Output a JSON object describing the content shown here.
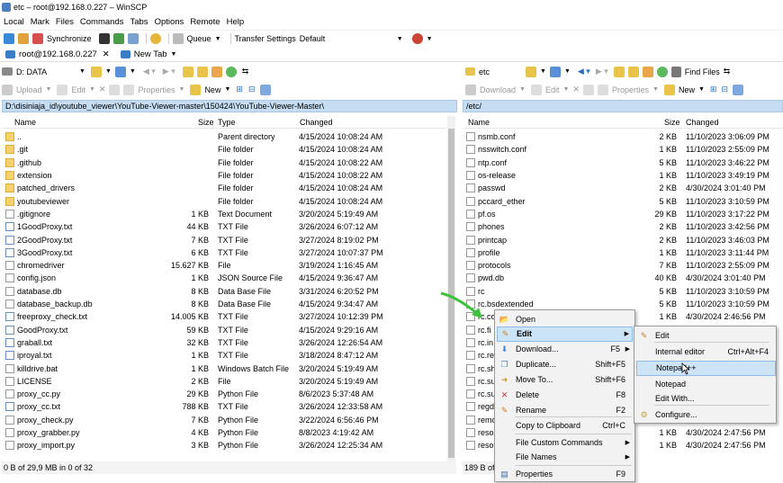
{
  "window": {
    "title": "etc – root@192.168.0.227 – WinSCP"
  },
  "menubar": [
    "Local",
    "Mark",
    "Files",
    "Commands",
    "Tabs",
    "Options",
    "Remote",
    "Help"
  ],
  "toolbar": {
    "synchronize": "Synchronize",
    "queue": "Queue",
    "transfer_settings": "Transfer Settings",
    "transfer_value": "Default"
  },
  "tabs": {
    "session": "root@192.168.0.227",
    "new_tab": "New Tab"
  },
  "left": {
    "drive": "D: DATA",
    "upload": "Upload",
    "edit": "Edit",
    "properties": "Properties",
    "new": "New",
    "path": "D:\\disiniaja_id\\youtube_viewer\\YouTube-Viewer-master\\150424\\YouTube-Viewer-Master\\",
    "columns": [
      "Name",
      "Size",
      "Type",
      "Changed"
    ],
    "rows": [
      {
        "name": "..",
        "size": "",
        "type": "Parent directory",
        "changed": "4/15/2024 10:08:24 AM",
        "icon": "up"
      },
      {
        "name": ".git",
        "size": "",
        "type": "File folder",
        "changed": "4/15/2024 10:08:24 AM",
        "icon": "folder"
      },
      {
        "name": ".github",
        "size": "",
        "type": "File folder",
        "changed": "4/15/2024 10:08:22 AM",
        "icon": "folder"
      },
      {
        "name": "extension",
        "size": "",
        "type": "File folder",
        "changed": "4/15/2024 10:08:22 AM",
        "icon": "folder"
      },
      {
        "name": "patched_drivers",
        "size": "",
        "type": "File folder",
        "changed": "4/15/2024 10:08:24 AM",
        "icon": "folder"
      },
      {
        "name": "youtubeviewer",
        "size": "",
        "type": "File folder",
        "changed": "4/15/2024 10:08:24 AM",
        "icon": "folder"
      },
      {
        "name": ".gitignore",
        "size": "1 KB",
        "type": "Text Document",
        "changed": "3/20/2024 5:19:49 AM",
        "icon": "file"
      },
      {
        "name": "1GoodProxy.txt",
        "size": "44 KB",
        "type": "TXT File",
        "changed": "3/26/2024 6:07:12 AM",
        "icon": "txt"
      },
      {
        "name": "2GoodProxy.txt",
        "size": "7 KB",
        "type": "TXT File",
        "changed": "3/27/2024 8:19:02 PM",
        "icon": "txt"
      },
      {
        "name": "3GoodProxy.txt",
        "size": "6 KB",
        "type": "TXT File",
        "changed": "3/27/2024 10:07:37 PM",
        "icon": "txt"
      },
      {
        "name": "chromedriver",
        "size": "15.627 KB",
        "type": "File",
        "changed": "3/19/2024 1:16:45 AM",
        "icon": "file"
      },
      {
        "name": "config.json",
        "size": "1 KB",
        "type": "JSON Source File",
        "changed": "4/15/2024 9:36:47 AM",
        "icon": "file"
      },
      {
        "name": "database.db",
        "size": "8 KB",
        "type": "Data Base File",
        "changed": "3/31/2024 6:20:52 PM",
        "icon": "file"
      },
      {
        "name": "database_backup.db",
        "size": "8 KB",
        "type": "Data Base File",
        "changed": "4/15/2024 9:34:47 AM",
        "icon": "file"
      },
      {
        "name": "freeproxy_check.txt",
        "size": "14.005 KB",
        "type": "TXT File",
        "changed": "3/27/2024 10:12:39 PM",
        "icon": "txt"
      },
      {
        "name": "GoodProxy.txt",
        "size": "59 KB",
        "type": "TXT File",
        "changed": "4/15/2024 9:29:16 AM",
        "icon": "txt"
      },
      {
        "name": "graball.txt",
        "size": "32 KB",
        "type": "TXT File",
        "changed": "3/26/2024 12:26:54 AM",
        "icon": "txt"
      },
      {
        "name": "iproyal.txt",
        "size": "1 KB",
        "type": "TXT File",
        "changed": "3/18/2024 8:47:12 AM",
        "icon": "txt"
      },
      {
        "name": "killdrive.bat",
        "size": "1 KB",
        "type": "Windows Batch File",
        "changed": "3/20/2024 5:19:49 AM",
        "icon": "file"
      },
      {
        "name": "LICENSE",
        "size": "2 KB",
        "type": "File",
        "changed": "3/20/2024 5:19:49 AM",
        "icon": "file"
      },
      {
        "name": "proxy_cc.py",
        "size": "29 KB",
        "type": "Python File",
        "changed": "8/6/2023 5:37:48 AM",
        "icon": "file"
      },
      {
        "name": "proxy_cc.txt",
        "size": "788 KB",
        "type": "TXT File",
        "changed": "3/26/2024 12:33:58 AM",
        "icon": "txt"
      },
      {
        "name": "proxy_check.py",
        "size": "7 KB",
        "type": "Python File",
        "changed": "3/22/2024 6:56:46 PM",
        "icon": "file"
      },
      {
        "name": "proxy_grabber.py",
        "size": "4 KB",
        "type": "Python File",
        "changed": "8/8/2023 4:19:42 AM",
        "icon": "file"
      },
      {
        "name": "proxy_import.py",
        "size": "3 KB",
        "type": "Python File",
        "changed": "3/26/2024 12:25:34 AM",
        "icon": "file"
      }
    ],
    "status": "0 B of 29,9 MB in 0 of 32"
  },
  "right": {
    "folder": "etc",
    "find_files": "Find Files",
    "download": "Download",
    "edit": "Edit",
    "properties": "Properties",
    "new": "New",
    "path": "/etc/",
    "columns": [
      "Name",
      "Size",
      "Changed"
    ],
    "rows": [
      {
        "name": "nsmb.conf",
        "size": "2 KB",
        "changed": "11/10/2023 3:06:09 PM"
      },
      {
        "name": "nsswitch.conf",
        "size": "1 KB",
        "changed": "11/10/2023 2:55:09 PM"
      },
      {
        "name": "ntp.conf",
        "size": "5 KB",
        "changed": "11/10/2023 3:46:22 PM"
      },
      {
        "name": "os-release",
        "size": "1 KB",
        "changed": "11/10/2023 3:49:19 PM"
      },
      {
        "name": "passwd",
        "size": "2 KB",
        "changed": "4/30/2024 3:01:40 PM"
      },
      {
        "name": "pccard_ether",
        "size": "5 KB",
        "changed": "11/10/2023 3:10:59 PM"
      },
      {
        "name": "pf.os",
        "size": "29 KB",
        "changed": "11/10/2023 3:17:22 PM"
      },
      {
        "name": "phones",
        "size": "2 KB",
        "changed": "11/10/2023 3:42:56 PM"
      },
      {
        "name": "printcap",
        "size": "2 KB",
        "changed": "11/10/2023 3:46:03 PM"
      },
      {
        "name": "profile",
        "size": "1 KB",
        "changed": "11/10/2023 3:11:44 PM"
      },
      {
        "name": "protocols",
        "size": "7 KB",
        "changed": "11/10/2023 2:55:09 PM"
      },
      {
        "name": "pwd.db",
        "size": "40 KB",
        "changed": "4/30/2024 3:01:40 PM"
      },
      {
        "name": "rc",
        "size": "5 KB",
        "changed": "11/10/2023 3:10:59 PM"
      },
      {
        "name": "rc.bsdextended",
        "size": "5 KB",
        "changed": "11/10/2023 3:10:59 PM"
      },
      {
        "name": "rc.co",
        "size": "1 KB",
        "changed": "4/30/2024 2:46:56 PM"
      },
      {
        "name": "rc.fi",
        "size": "",
        "changed": ""
      },
      {
        "name": "rc.in",
        "size": "",
        "changed": ""
      },
      {
        "name": "rc.re",
        "size": "",
        "changed": ""
      },
      {
        "name": "rc.sh",
        "size": "",
        "changed": ""
      },
      {
        "name": "rc.su",
        "size": "",
        "changed": ""
      },
      {
        "name": "rc.su",
        "size": "",
        "changed": ""
      },
      {
        "name": "regd",
        "size": "",
        "changed": ""
      },
      {
        "name": "remo",
        "size": "",
        "changed": ""
      },
      {
        "name": "resol",
        "size": "1 KB",
        "changed": "4/30/2024 2:47:56 PM"
      },
      {
        "name": "resol",
        "size": "1 KB",
        "changed": "4/30/2024 2:47:56 PM"
      }
    ],
    "status": "189 B of"
  },
  "context_menu": {
    "items": [
      {
        "label": "Open",
        "shortcut": "",
        "icon": "open-icon"
      },
      {
        "label": "Edit",
        "shortcut": "",
        "icon": "edit-icon",
        "submenu": true
      },
      {
        "label": "Download...",
        "shortcut": "F5",
        "icon": "download-icon",
        "submenu": true
      },
      {
        "label": "Duplicate...",
        "shortcut": "Shift+F5",
        "icon": "duplicate-icon"
      },
      {
        "label": "Move To...",
        "shortcut": "Shift+F6",
        "icon": "move-icon"
      },
      {
        "label": "Delete",
        "shortcut": "F8",
        "icon": "delete-icon"
      },
      {
        "label": "Rename",
        "shortcut": "F2",
        "icon": "rename-icon"
      },
      {
        "label": "Copy to Clipboard",
        "shortcut": "Ctrl+C",
        "icon": ""
      },
      {
        "label": "File Custom Commands",
        "shortcut": "",
        "icon": "",
        "submenu": true
      },
      {
        "label": "File Names",
        "shortcut": "",
        "icon": "",
        "submenu": true
      },
      {
        "label": "Properties",
        "shortcut": "F9",
        "icon": "properties-icon"
      }
    ]
  },
  "submenu": {
    "items": [
      {
        "label": "Edit",
        "shortcut": ""
      },
      {
        "label": "Internal editor",
        "shortcut": "Ctrl+Alt+F4"
      },
      {
        "label": "Notepad++",
        "shortcut": ""
      },
      {
        "label": "Notepad",
        "shortcut": ""
      },
      {
        "label": "Edit With...",
        "shortcut": ""
      },
      {
        "label": "Configure...",
        "shortcut": ""
      }
    ]
  },
  "colors": {
    "accent": "#cde4f7",
    "path_bar": "#c5dcf2",
    "arrow": "#3cc23c"
  }
}
